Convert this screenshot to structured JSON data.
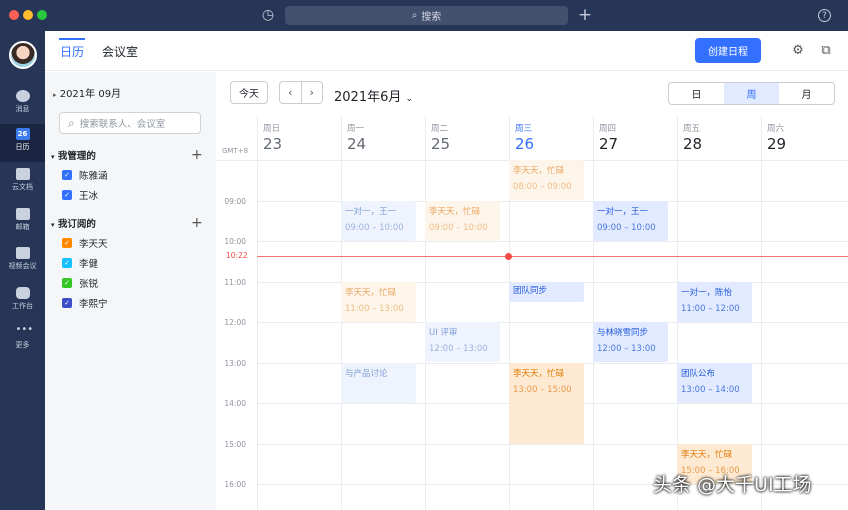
{
  "titlebar": {
    "search_placeholder": "搜索",
    "icons": [
      "history-icon",
      "plus-icon",
      "help-icon"
    ]
  },
  "nav": {
    "items": [
      {
        "label": "消息",
        "icon": "message-icon"
      },
      {
        "label": "日历",
        "icon": "calendar-icon",
        "badge": "26",
        "active": true
      },
      {
        "label": "云文档",
        "icon": "document-icon"
      },
      {
        "label": "邮箱",
        "icon": "mail-icon"
      },
      {
        "label": "视频会议",
        "icon": "video-icon"
      },
      {
        "label": "工作台",
        "icon": "apps-icon"
      },
      {
        "label": "更多",
        "icon": "more-icon"
      }
    ]
  },
  "header": {
    "tabs": [
      "日历",
      "会议室"
    ],
    "create_label": "创建日程"
  },
  "sidebar": {
    "mini_calendar_label": "2021年  09月",
    "search_placeholder": "搜索联系人、会议室",
    "managed_title": "我管理的",
    "managed": [
      {
        "name": "陈雅涵",
        "color": "#3370ff"
      },
      {
        "name": "王冰",
        "color": "#3370ff"
      }
    ],
    "subscribed_title": "我订阅的",
    "subscribed": [
      {
        "name": "李天天",
        "color": "#ff8800"
      },
      {
        "name": "李健",
        "color": "#14c0ff"
      },
      {
        "name": "张锐",
        "color": "#34c724"
      },
      {
        "name": "李熙宁",
        "color": "#3b4dc7"
      }
    ]
  },
  "toolbar": {
    "today": "今天",
    "month_title": "2021年6月",
    "views": [
      "日",
      "周",
      "月"
    ],
    "active_view": "周"
  },
  "week": {
    "timezone": "GMT+8",
    "days": [
      {
        "weekday": "周日",
        "date": "23"
      },
      {
        "weekday": "周一",
        "date": "24"
      },
      {
        "weekday": "周二",
        "date": "25"
      },
      {
        "weekday": "周三",
        "date": "26",
        "today": true
      },
      {
        "weekday": "周四",
        "date": "27"
      },
      {
        "weekday": "周五",
        "date": "28"
      },
      {
        "weekday": "周六",
        "date": "29"
      }
    ],
    "times": [
      "09:00",
      "10:00",
      "11:00",
      "12:00",
      "13:00",
      "14:00",
      "15:00",
      "16:00"
    ],
    "now_label": "10:22"
  },
  "events": {
    "e1": {
      "title": "李天天，忙碌",
      "time": "08:00 – 09:00"
    },
    "e2": {
      "title": "一对一，王一",
      "time": "09:00 – 10:00"
    },
    "e3": {
      "title": "李天天，忙碌",
      "time": "09:00 – 10:00"
    },
    "e4": {
      "title": "一对一，王一",
      "time": "09:00 – 10:00"
    },
    "e5": {
      "title": "李天天，忙碌",
      "time": "11:00 – 13:00"
    },
    "e6": {
      "title": "团队同步"
    },
    "e7": {
      "title": "一对一，陈怡",
      "time": "11:00 – 12:00"
    },
    "e8": {
      "title": "UI 评审",
      "time": "12:00 – 13:00"
    },
    "e9": {
      "title": "与林晓雪同步",
      "time": "12:00 – 13:00"
    },
    "e10": {
      "title": "与产品讨论"
    },
    "e11": {
      "title": "李天天，忙碌",
      "time": "13:00 – 15:00"
    },
    "e12": {
      "title": "团队公布",
      "time": "13:00 – 14:00"
    },
    "e13": {
      "title": "李天天，忙碌",
      "time": "15:00 – 16:00"
    }
  },
  "watermark": "头条 @大千UI工场"
}
